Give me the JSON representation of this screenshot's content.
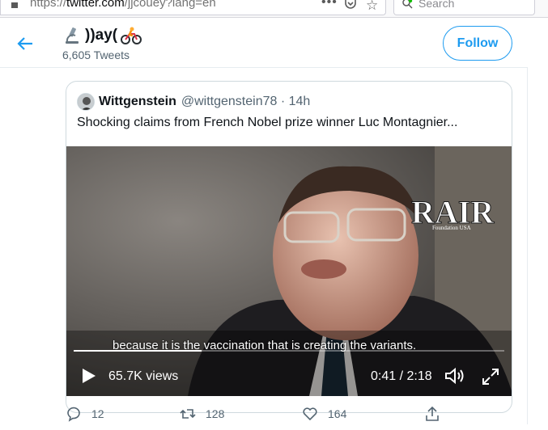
{
  "browser": {
    "url_prefix": "https://",
    "url_host": "twitter.com",
    "url_path": "/jjcouey?lang=en",
    "page_actions_icon": "•••",
    "search_placeholder": "Search"
  },
  "header": {
    "display_name": "))ay(",
    "emoji_left": "microscope-emoji",
    "emoji_right": "cyclist-emoji",
    "tweets_count": "6,605 Tweets",
    "follow_label": "Follow",
    "peek_text": "y"
  },
  "quoted_tweet": {
    "author_name": "Wittgenstein",
    "author_handle": "@wittgenstein78 · 14h",
    "text": "Shocking claims from French Nobel prize winner Luc Montagnier...",
    "video": {
      "watermark": "RAIR",
      "watermark_sub": "Foundation USA",
      "subtitle": "because it is the vaccination that is creating the variants.",
      "views": "65.7K views",
      "time": "0:41 / 2:18",
      "progress": 0.297
    }
  },
  "actions": {
    "replies": "12",
    "retweets": "128",
    "likes": "164"
  },
  "colors": {
    "accent": "#1d9bf0",
    "text_secondary": "#536471",
    "border": "#cfd9de"
  }
}
